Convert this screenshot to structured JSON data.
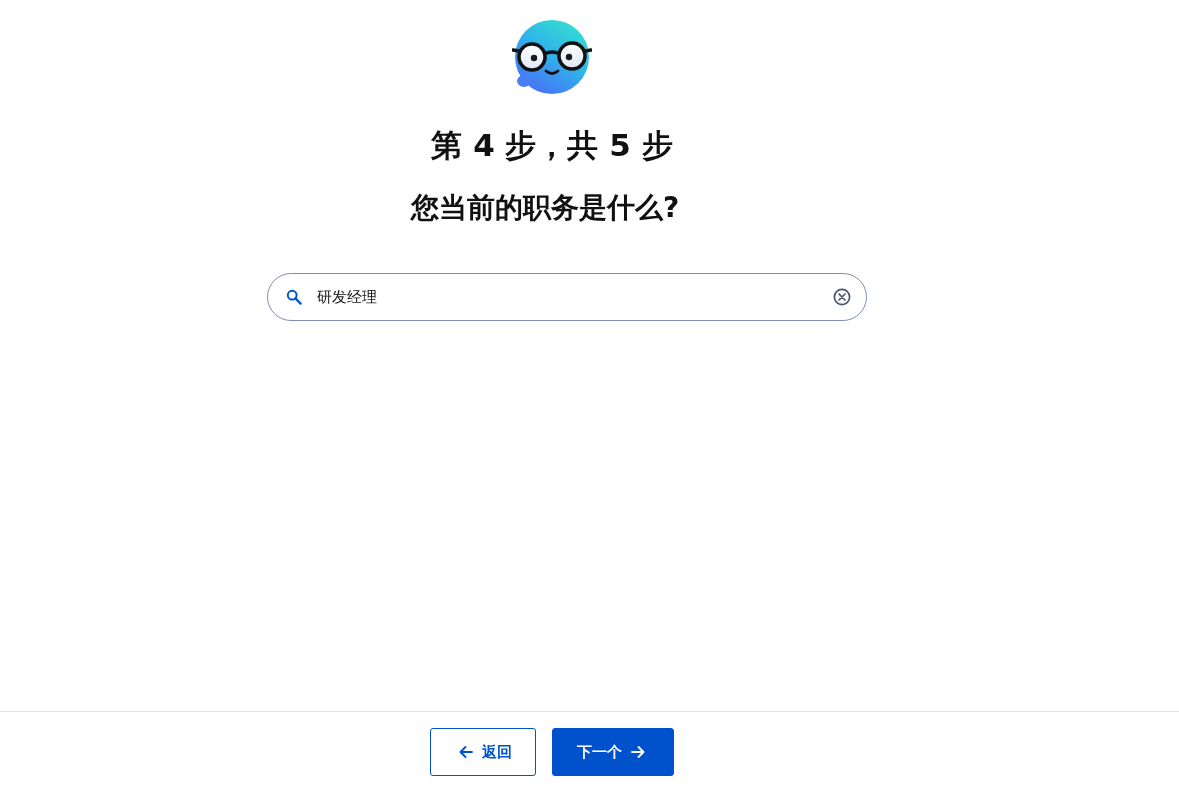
{
  "progress": "第 4 步，共 5 步",
  "question": "您当前的职务是什么?",
  "search": {
    "value": "研发经理"
  },
  "buttons": [
    {
      "kind": "back",
      "label": "返回"
    },
    {
      "kind": "next",
      "label": "下一个"
    }
  ]
}
